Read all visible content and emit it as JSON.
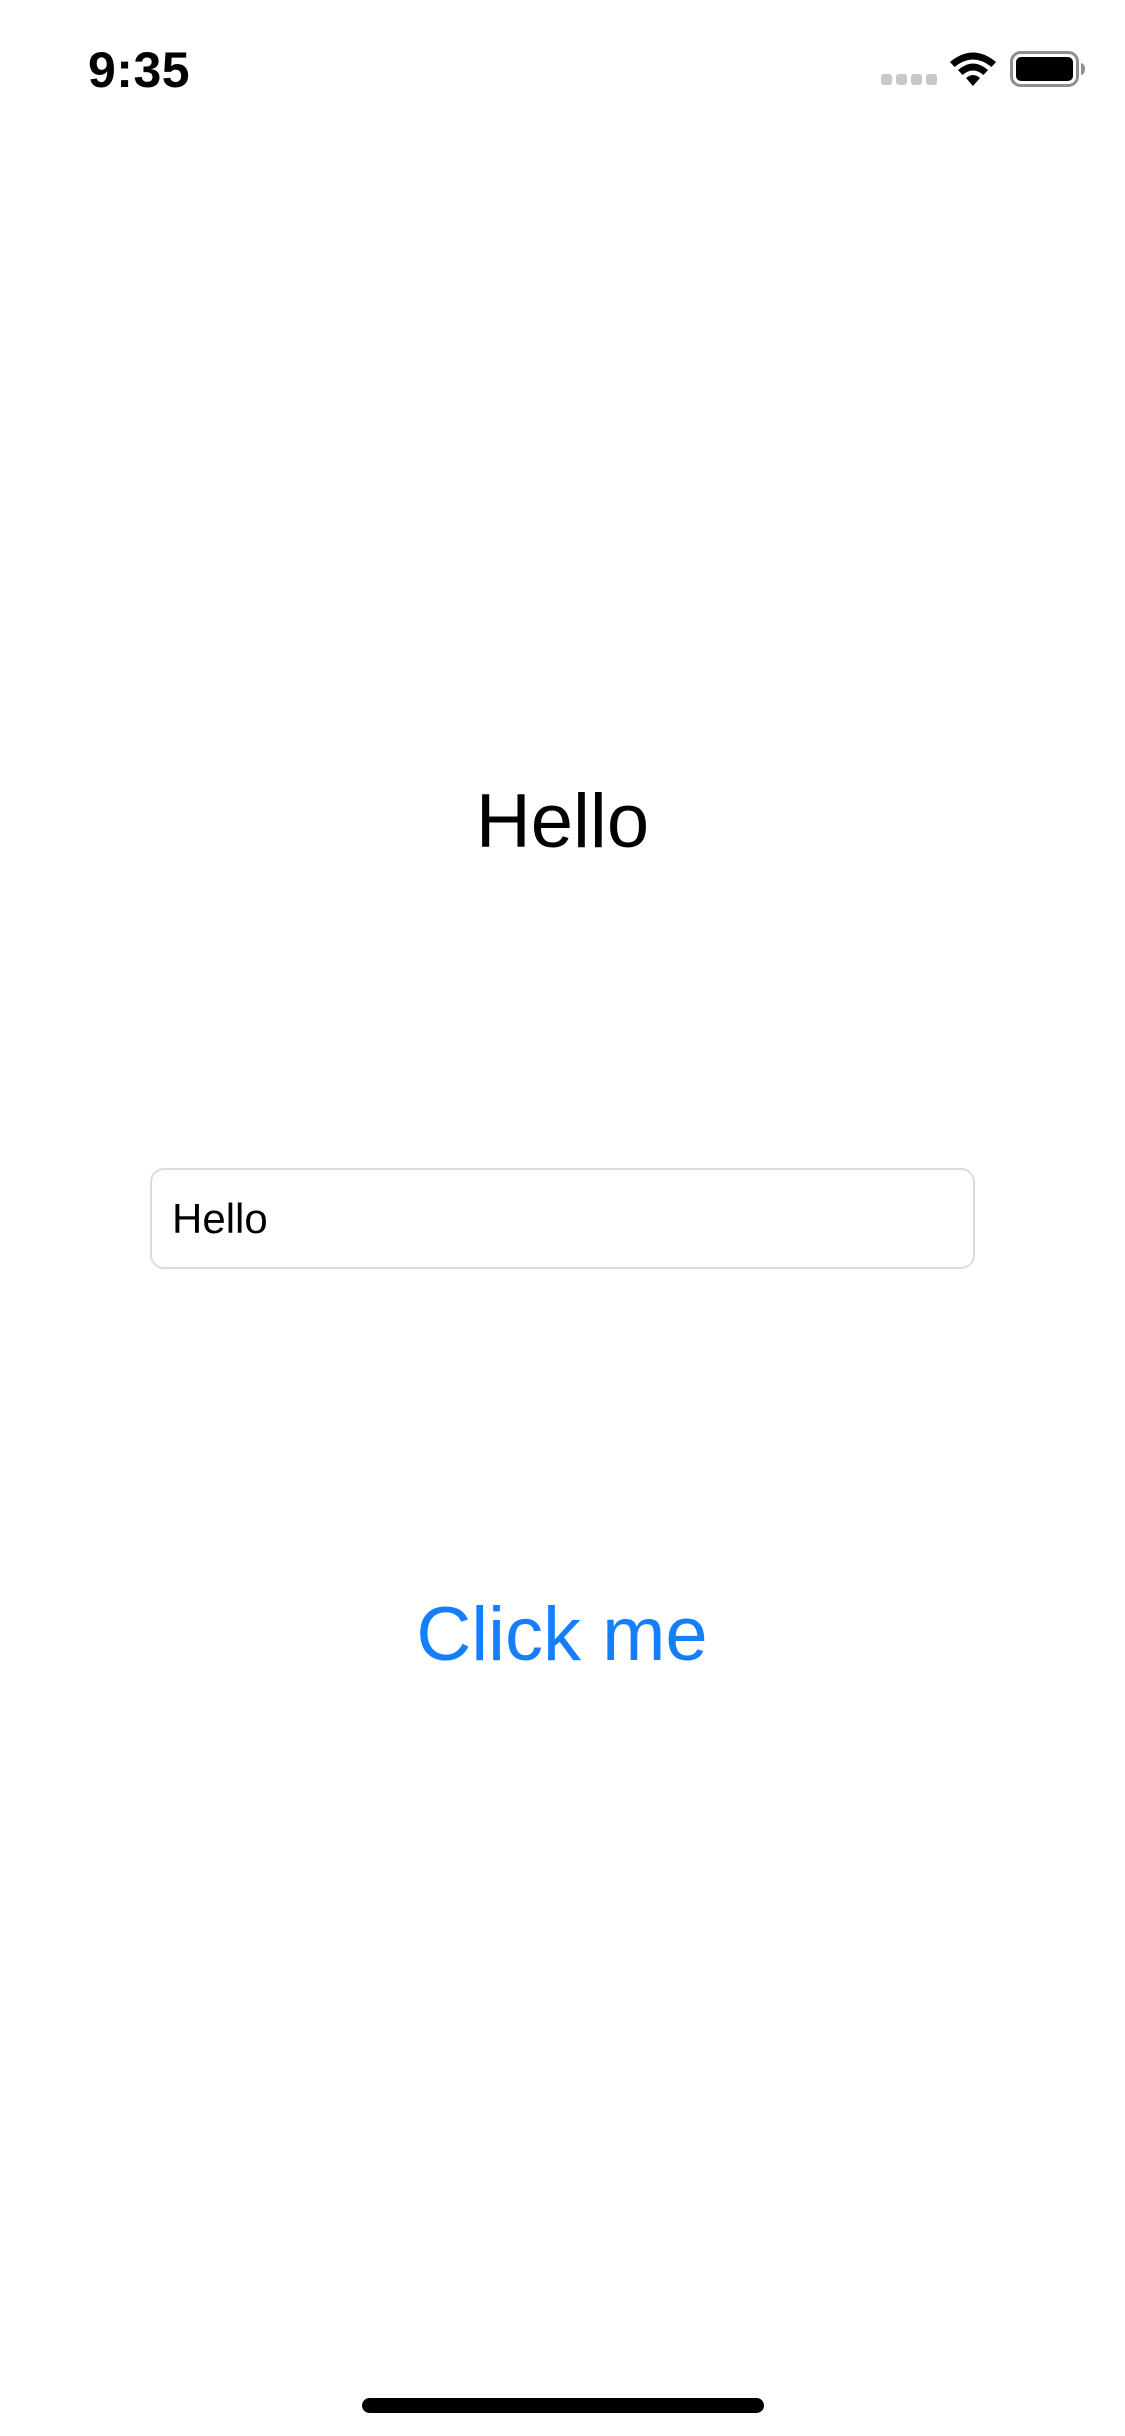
{
  "status_bar": {
    "time": "9:35",
    "icons": [
      "cellular-signal-icon",
      "wifi-icon",
      "battery-icon"
    ]
  },
  "main": {
    "title": "Hello",
    "text_field": {
      "value": "Hello",
      "placeholder": ""
    },
    "button_label": "Click me"
  },
  "colors": {
    "accent": "#147efb",
    "text": "#000000",
    "background": "#ffffff",
    "field_border": "#dcdcdc"
  }
}
